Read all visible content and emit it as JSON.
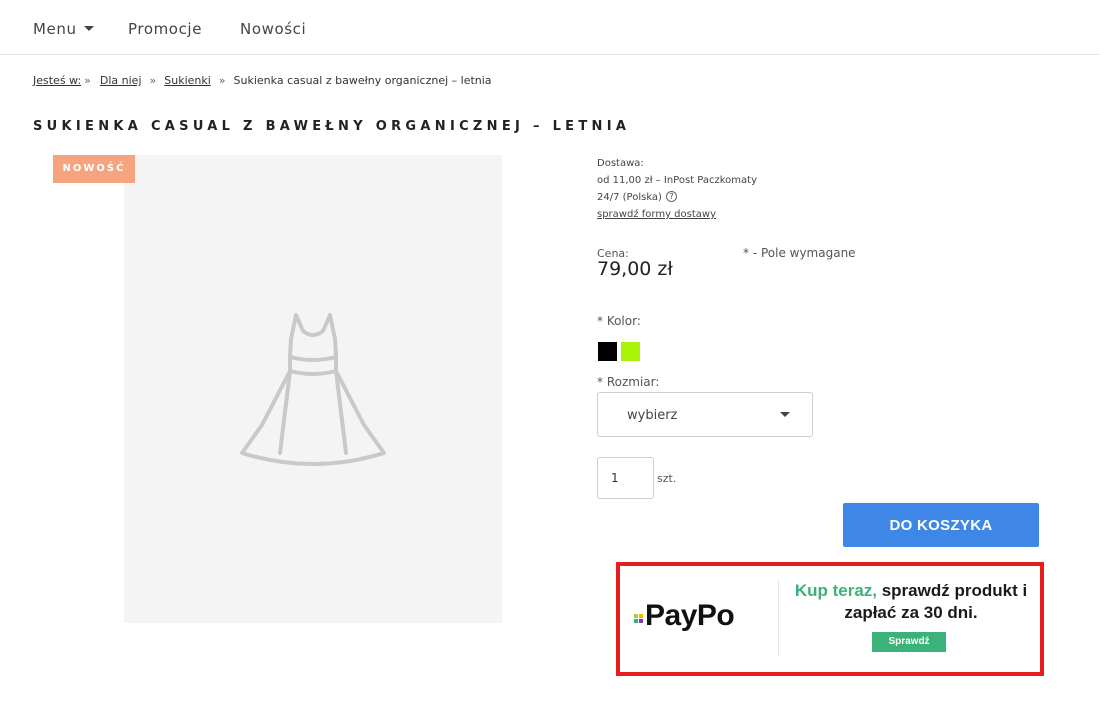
{
  "nav": {
    "menu_label": "Menu",
    "promotions_label": "Promocje",
    "new_label": "Nowości"
  },
  "breadcrumb": {
    "prefix": "Jesteś w:",
    "separator": "»",
    "items": [
      "Dla niej",
      "Sukienki"
    ],
    "current": "Sukienka casual z bawełny organicznej – letnia"
  },
  "product": {
    "title": "SUKIENKA CASUAL Z BAWEŁNY ORGANICZNEJ – LETNIA",
    "badge": "NOWOŚĆ",
    "image_icon": "dress-placeholder-icon"
  },
  "delivery": {
    "label": "Dostawa:",
    "line1": "od 11,00 zł – InPost Paczkomaty",
    "line2": "24/7 (Polska)",
    "help_icon": "?",
    "link": "sprawdź formy dostawy"
  },
  "price": {
    "label": "Cena:",
    "value": "79,00 zł",
    "required_note": "* - Pole wymagane"
  },
  "color": {
    "label": "* Kolor:",
    "swatches": [
      "#000000",
      "#aaf20a"
    ]
  },
  "size": {
    "label": "* Rozmiar:",
    "selected": "wybierz"
  },
  "quantity": {
    "value": "1",
    "unit": "szt."
  },
  "cart": {
    "button_label": "DO KOSZYKA",
    "button_color": "#3f87e6"
  },
  "paypo": {
    "logo": "PayPo",
    "highlight": "Kup teraz,",
    "text_rest": " sprawdź produkt i zapłać za 30 dni.",
    "button_label": "Sprawdź",
    "accent_color": "#3bb27a",
    "border_color": "#e81d1d"
  }
}
